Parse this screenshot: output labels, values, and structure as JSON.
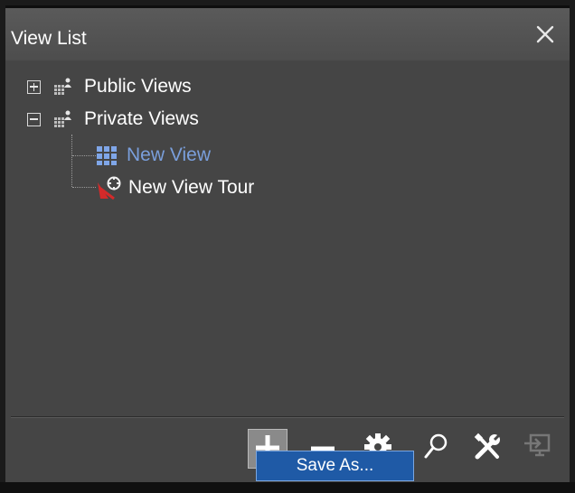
{
  "panel": {
    "title": "View List",
    "close_icon": "close-icon"
  },
  "tree": {
    "items": [
      {
        "label": "Public Views",
        "expander": "plus",
        "icon": "views-group-icon"
      },
      {
        "label": "Private Views",
        "expander": "minus",
        "icon": "views-group-icon"
      },
      {
        "label": "New View",
        "icon": "grid-view-icon",
        "selected": true
      },
      {
        "label": "New View Tour",
        "icon": "view-tour-icon"
      }
    ]
  },
  "toolbar": {
    "buttons": [
      "add-icon",
      "remove-icon",
      "settings-icon",
      "search-icon",
      "tools-icon",
      "export-icon"
    ]
  },
  "popup_menu": {
    "save_as_label": "Save As..."
  },
  "colors": {
    "panel_bg": "#454545",
    "title_bg": "#555555",
    "selected_text": "#7a9fdc",
    "menu_highlight": "#1f5aa6"
  }
}
